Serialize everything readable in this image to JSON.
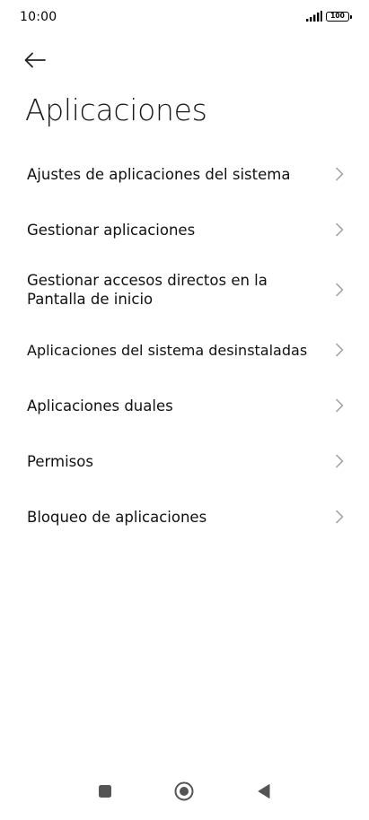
{
  "status_bar": {
    "time": "10:00",
    "battery_level": "100",
    "icons": [
      "signal-icon",
      "battery-icon"
    ]
  },
  "header": {
    "back_icon": "arrow-left-icon",
    "title": "Aplicaciones"
  },
  "settings": {
    "items": [
      {
        "label": "Ajustes de aplicaciones del sistema"
      },
      {
        "label": "Gestionar aplicaciones"
      },
      {
        "label": "Gestionar accesos directos en la Pantalla de inicio"
      },
      {
        "label": "Aplicaciones del sistema desinstaladas"
      },
      {
        "label": "Aplicaciones duales"
      },
      {
        "label": "Permisos"
      },
      {
        "label": "Bloqueo de aplicaciones"
      }
    ],
    "item_icon": "chevron-right-icon"
  },
  "nav_bar": {
    "icons": [
      "square-icon",
      "circle-home-icon",
      "triangle-back-icon"
    ]
  },
  "colors": {
    "background": "#ffffff",
    "text": "#111111",
    "chevron": "#9e9e9e"
  }
}
